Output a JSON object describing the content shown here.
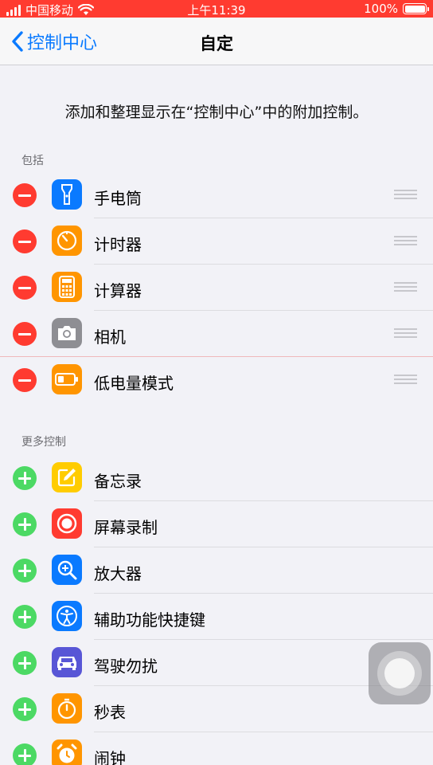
{
  "status_bar": {
    "carrier": "中国移动",
    "time": "上午11:39",
    "battery": "100%",
    "battery_level": 1.0
  },
  "nav": {
    "back_label": "控制中心",
    "title": "自定"
  },
  "description": "添加和整理显示在“控制中心”中的附加控制。",
  "included": {
    "header": "包括",
    "items": [
      {
        "label": "手电筒",
        "icon": "flashlight-icon",
        "color": "#0a7aff"
      },
      {
        "label": "计时器",
        "icon": "timer-icon",
        "color": "#ff9500"
      },
      {
        "label": "计算器",
        "icon": "calculator-icon",
        "color": "#ff9500"
      },
      {
        "label": "相机",
        "icon": "camera-icon",
        "color": "#8e8e93"
      },
      {
        "label": "低电量模式",
        "icon": "low-power-battery-icon",
        "color": "#ff9500"
      }
    ]
  },
  "more": {
    "header": "更多控制",
    "items": [
      {
        "label": "备忘录",
        "icon": "notes-icon",
        "color": "#ffcc00"
      },
      {
        "label": "屏幕录制",
        "icon": "screen-record-icon",
        "color": "#ff3b30"
      },
      {
        "label": "放大器",
        "icon": "magnifier-icon",
        "color": "#0a7aff"
      },
      {
        "label": "辅助功能快捷键",
        "icon": "accessibility-icon",
        "color": "#0a7aff"
      },
      {
        "label": "驾驶勿扰",
        "icon": "car-icon",
        "color": "#5856d6"
      },
      {
        "label": "秒表",
        "icon": "stopwatch-icon",
        "color": "#ff9500"
      },
      {
        "label": "闹钟",
        "icon": "alarm-clock-icon",
        "color": "#ff9500"
      }
    ]
  }
}
